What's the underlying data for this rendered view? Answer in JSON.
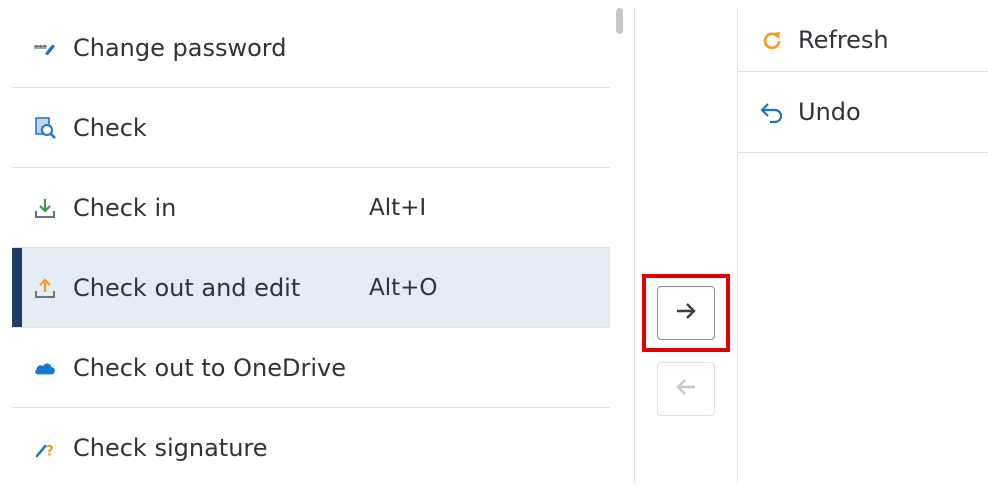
{
  "available_commands": {
    "items": [
      {
        "label": "Change password",
        "shortcut": "",
        "icon": "password-icon"
      },
      {
        "label": "Check",
        "shortcut": "",
        "icon": "check-document-icon"
      },
      {
        "label": "Check in",
        "shortcut": "Alt+I",
        "icon": "check-in-icon"
      },
      {
        "label": "Check out and edit",
        "shortcut": "Alt+O",
        "icon": "check-out-edit-icon",
        "selected": true
      },
      {
        "label": "Check out to OneDrive",
        "shortcut": "",
        "icon": "onedrive-cloud-icon"
      },
      {
        "label": "Check signature",
        "shortcut": "",
        "icon": "check-signature-icon"
      }
    ]
  },
  "move_buttons": {
    "add": {
      "icon": "arrow-right-icon",
      "enabled": true,
      "highlighted": true
    },
    "remove": {
      "icon": "arrow-left-icon",
      "enabled": false
    }
  },
  "selected_commands": {
    "items": [
      {
        "label": "Refresh",
        "icon": "refresh-icon"
      },
      {
        "label": "Undo",
        "icon": "undo-icon"
      }
    ]
  },
  "colors": {
    "selection_bg": "#e4ecf3",
    "selection_bar": "#1a3d63",
    "highlight_border": "#e00000",
    "accent_blue": "#1a73c9",
    "accent_orange": "#f39a1c",
    "accent_green": "#3a9a3a"
  }
}
